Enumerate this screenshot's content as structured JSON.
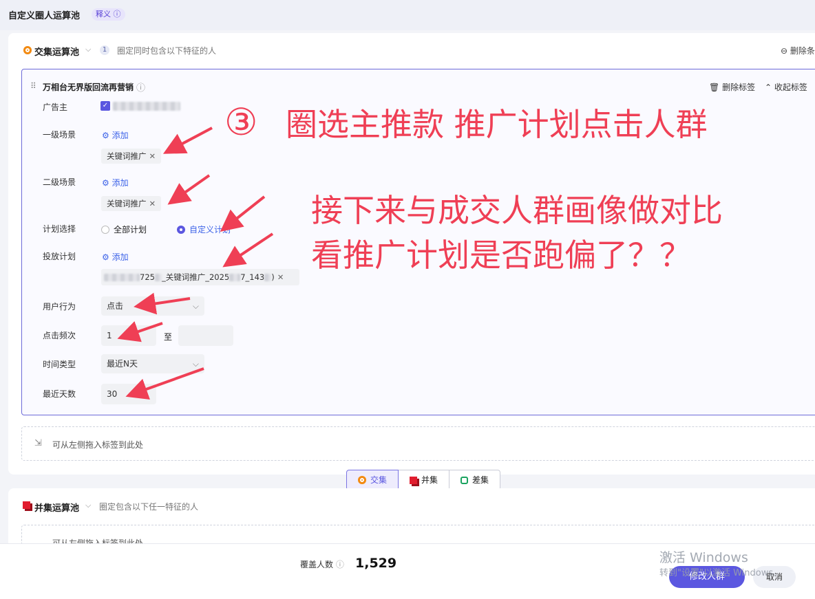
{
  "page": {
    "title": "自定义圈人运算池",
    "badge": "释义"
  },
  "pool1": {
    "title": "交集运算池",
    "count": "1",
    "desc": "圈定同时包含以下特征的人",
    "delete_label": "删除条"
  },
  "tag_block": {
    "title": "万相台无界版回流再营销",
    "delete_tag": "删除标签",
    "collapse_tag": "收起标签",
    "fields": {
      "advertiser": "广告主",
      "scene1": "一级场景",
      "scene2": "二级场景",
      "plan_select": "计划选择",
      "delivery_plan": "投放计划",
      "user_behavior": "用户行为",
      "click_freq": "点击频次",
      "time_type": "时间类型",
      "recent_days": "最近天数"
    },
    "add_label": "添加",
    "scene1_tag": "关键词推广",
    "scene2_tag": "关键词推广",
    "plan_all": "全部计划",
    "plan_custom": "自定义计划",
    "delivery_tag_a": "725",
    "delivery_tag_b": "_关键词推广_2025",
    "delivery_tag_c": "7_143",
    "delivery_tag_d": ")",
    "behavior_value": "点击",
    "freq_from": "1",
    "freq_to_sep": "至",
    "time_type_value": "最近N天",
    "days_value": "30"
  },
  "dropzone_text": "可从左侧拖入标签到此处",
  "ops": {
    "intersect": "交集",
    "union": "并集",
    "diff": "差集"
  },
  "pool2": {
    "title": "并集运算池",
    "desc": "圈定包含以下任一特征的人",
    "dropzone_text": "可从左侧拖入标签到此处"
  },
  "footer": {
    "coverage_label": "覆盖人数",
    "coverage_value": "1,529",
    "modify_button": "修改人群",
    "cancel_button": "取消"
  },
  "annotation": {
    "step": "③",
    "headline": "圈选主推款 推广计划点击人群",
    "note_line1": "接下来与成交人群画像做对比",
    "note_line2": "看推广计划是否跑偏了？？"
  },
  "watermark": {
    "line1": "激活 Windows",
    "line2": "转到\"设置\"以激活 Windows。"
  },
  "colors": {
    "accent": "#5b57e0",
    "annotation": "#ef3f55",
    "link": "#3d63e8"
  }
}
